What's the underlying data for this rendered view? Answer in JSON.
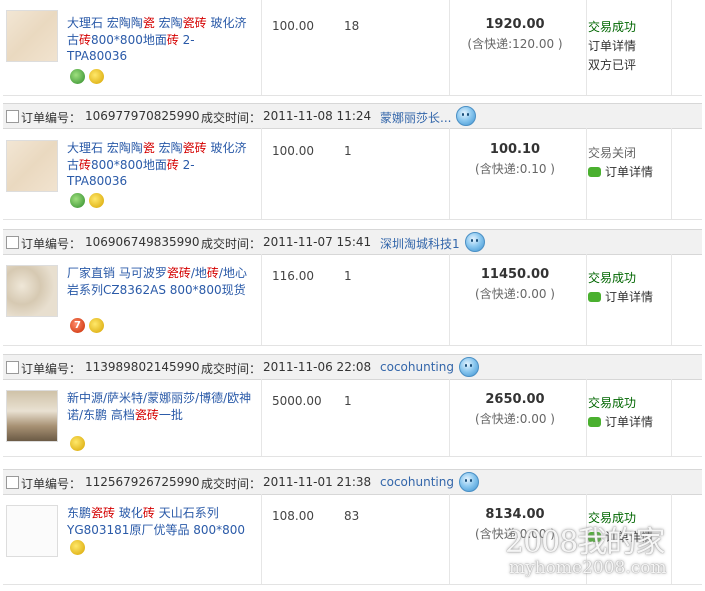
{
  "watermark": {
    "line1": "2008我的家",
    "line2": "myhome2008.com"
  },
  "orders": [
    {
      "header": null,
      "title_parts": [
        {
          "t": "大理石 宏陶陶",
          "hl": false
        },
        {
          "t": "瓷",
          "hl": true
        },
        {
          "t": " 宏陶",
          "hl": false
        },
        {
          "t": "瓷砖",
          "hl": true
        },
        {
          "t": " 玻化济古",
          "hl": false
        },
        {
          "t": "砖",
          "hl": true
        },
        {
          "t": "800*800地面",
          "hl": false
        },
        {
          "t": "砖",
          "hl": true
        },
        {
          "t": " 2-TPA80036",
          "hl": false
        }
      ],
      "icons": [
        "green",
        "yellow"
      ],
      "price": "100.00",
      "qty": "18",
      "total": "1920.00",
      "ship": "(含快递:120.00 )",
      "status": "交易成功",
      "detail": "订单详情",
      "extra": "双方已评",
      "thumb": "tile"
    },
    {
      "header": {
        "label_no": "订单编号：",
        "no": "106977970825990",
        "label_time": "成交时间：",
        "time": "2011-11-08 11:24",
        "shop": "蒙娜丽莎长..."
      },
      "title_parts": [
        {
          "t": "大理石 宏陶陶",
          "hl": false
        },
        {
          "t": "瓷",
          "hl": true
        },
        {
          "t": " 宏陶",
          "hl": false
        },
        {
          "t": "瓷砖",
          "hl": true
        },
        {
          "t": " 玻化济古",
          "hl": false
        },
        {
          "t": "砖",
          "hl": true
        },
        {
          "t": "800*800地面",
          "hl": false
        },
        {
          "t": "砖",
          "hl": true
        },
        {
          "t": " 2-TPA80036",
          "hl": false
        }
      ],
      "icons": [
        "green",
        "yellow"
      ],
      "price": "100.00",
      "qty": "1",
      "total": "100.10",
      "ship": "(含快递:0.10 )",
      "status": "交易关闭",
      "detail": "订单详情",
      "extra": "",
      "thumb": "tile"
    },
    {
      "header": {
        "label_no": "订单编号：",
        "no": "106906749835990",
        "label_time": "成交时间：",
        "time": "2011-11-07 15:41",
        "shop": "深圳淘城科技1"
      },
      "title_parts": [
        {
          "t": "厂家直销 马可波罗",
          "hl": false
        },
        {
          "t": "瓷砖",
          "hl": true
        },
        {
          "t": "/地",
          "hl": false
        },
        {
          "t": "砖",
          "hl": true
        },
        {
          "t": "/地心岩系列CZ8362AS 800*800现货",
          "hl": false
        }
      ],
      "icons": [
        "seven",
        "yellow"
      ],
      "price": "116.00",
      "qty": "1",
      "total": "11450.00",
      "ship": "(含快递:0.00 )",
      "status": "交易成功",
      "detail": "订单详情",
      "extra": "",
      "thumb": "marble"
    },
    {
      "header": {
        "label_no": "订单编号：",
        "no": "113989802145990",
        "label_time": "成交时间：",
        "time": "2011-11-06 22:08",
        "shop": "cocohunting"
      },
      "title_parts": [
        {
          "t": "新中源/萨米特/蒙娜丽莎/博德/欧神诺/东鹏 高档",
          "hl": false
        },
        {
          "t": "瓷砖",
          "hl": true
        },
        {
          "t": "一批",
          "hl": false
        }
      ],
      "icons": [
        "yellow"
      ],
      "price": "5000.00",
      "qty": "1",
      "total": "2650.00",
      "ship": "(含快递:0.00 )",
      "status": "交易成功",
      "detail": "订单详情",
      "extra": "",
      "thumb": "room"
    },
    {
      "header": {
        "label_no": "订单编号：",
        "no": "112567926725990",
        "label_time": "成交时间：",
        "time": "2011-11-01 21:38",
        "shop": "cocohunting"
      },
      "title_parts": [
        {
          "t": "东鹏",
          "hl": false
        },
        {
          "t": "瓷砖",
          "hl": true
        },
        {
          "t": " 玻化",
          "hl": false
        },
        {
          "t": "砖",
          "hl": true
        },
        {
          "t": " 天山石系列YG803181原厂优等品 800*800",
          "hl": false
        }
      ],
      "icons": [
        "yellow"
      ],
      "price": "108.00",
      "qty": "83",
      "total": "8134.00",
      "ship": "(含快递:0.00 )",
      "status": "交易成功",
      "detail": "订单详情",
      "extra": "",
      "thumb": "white"
    }
  ]
}
